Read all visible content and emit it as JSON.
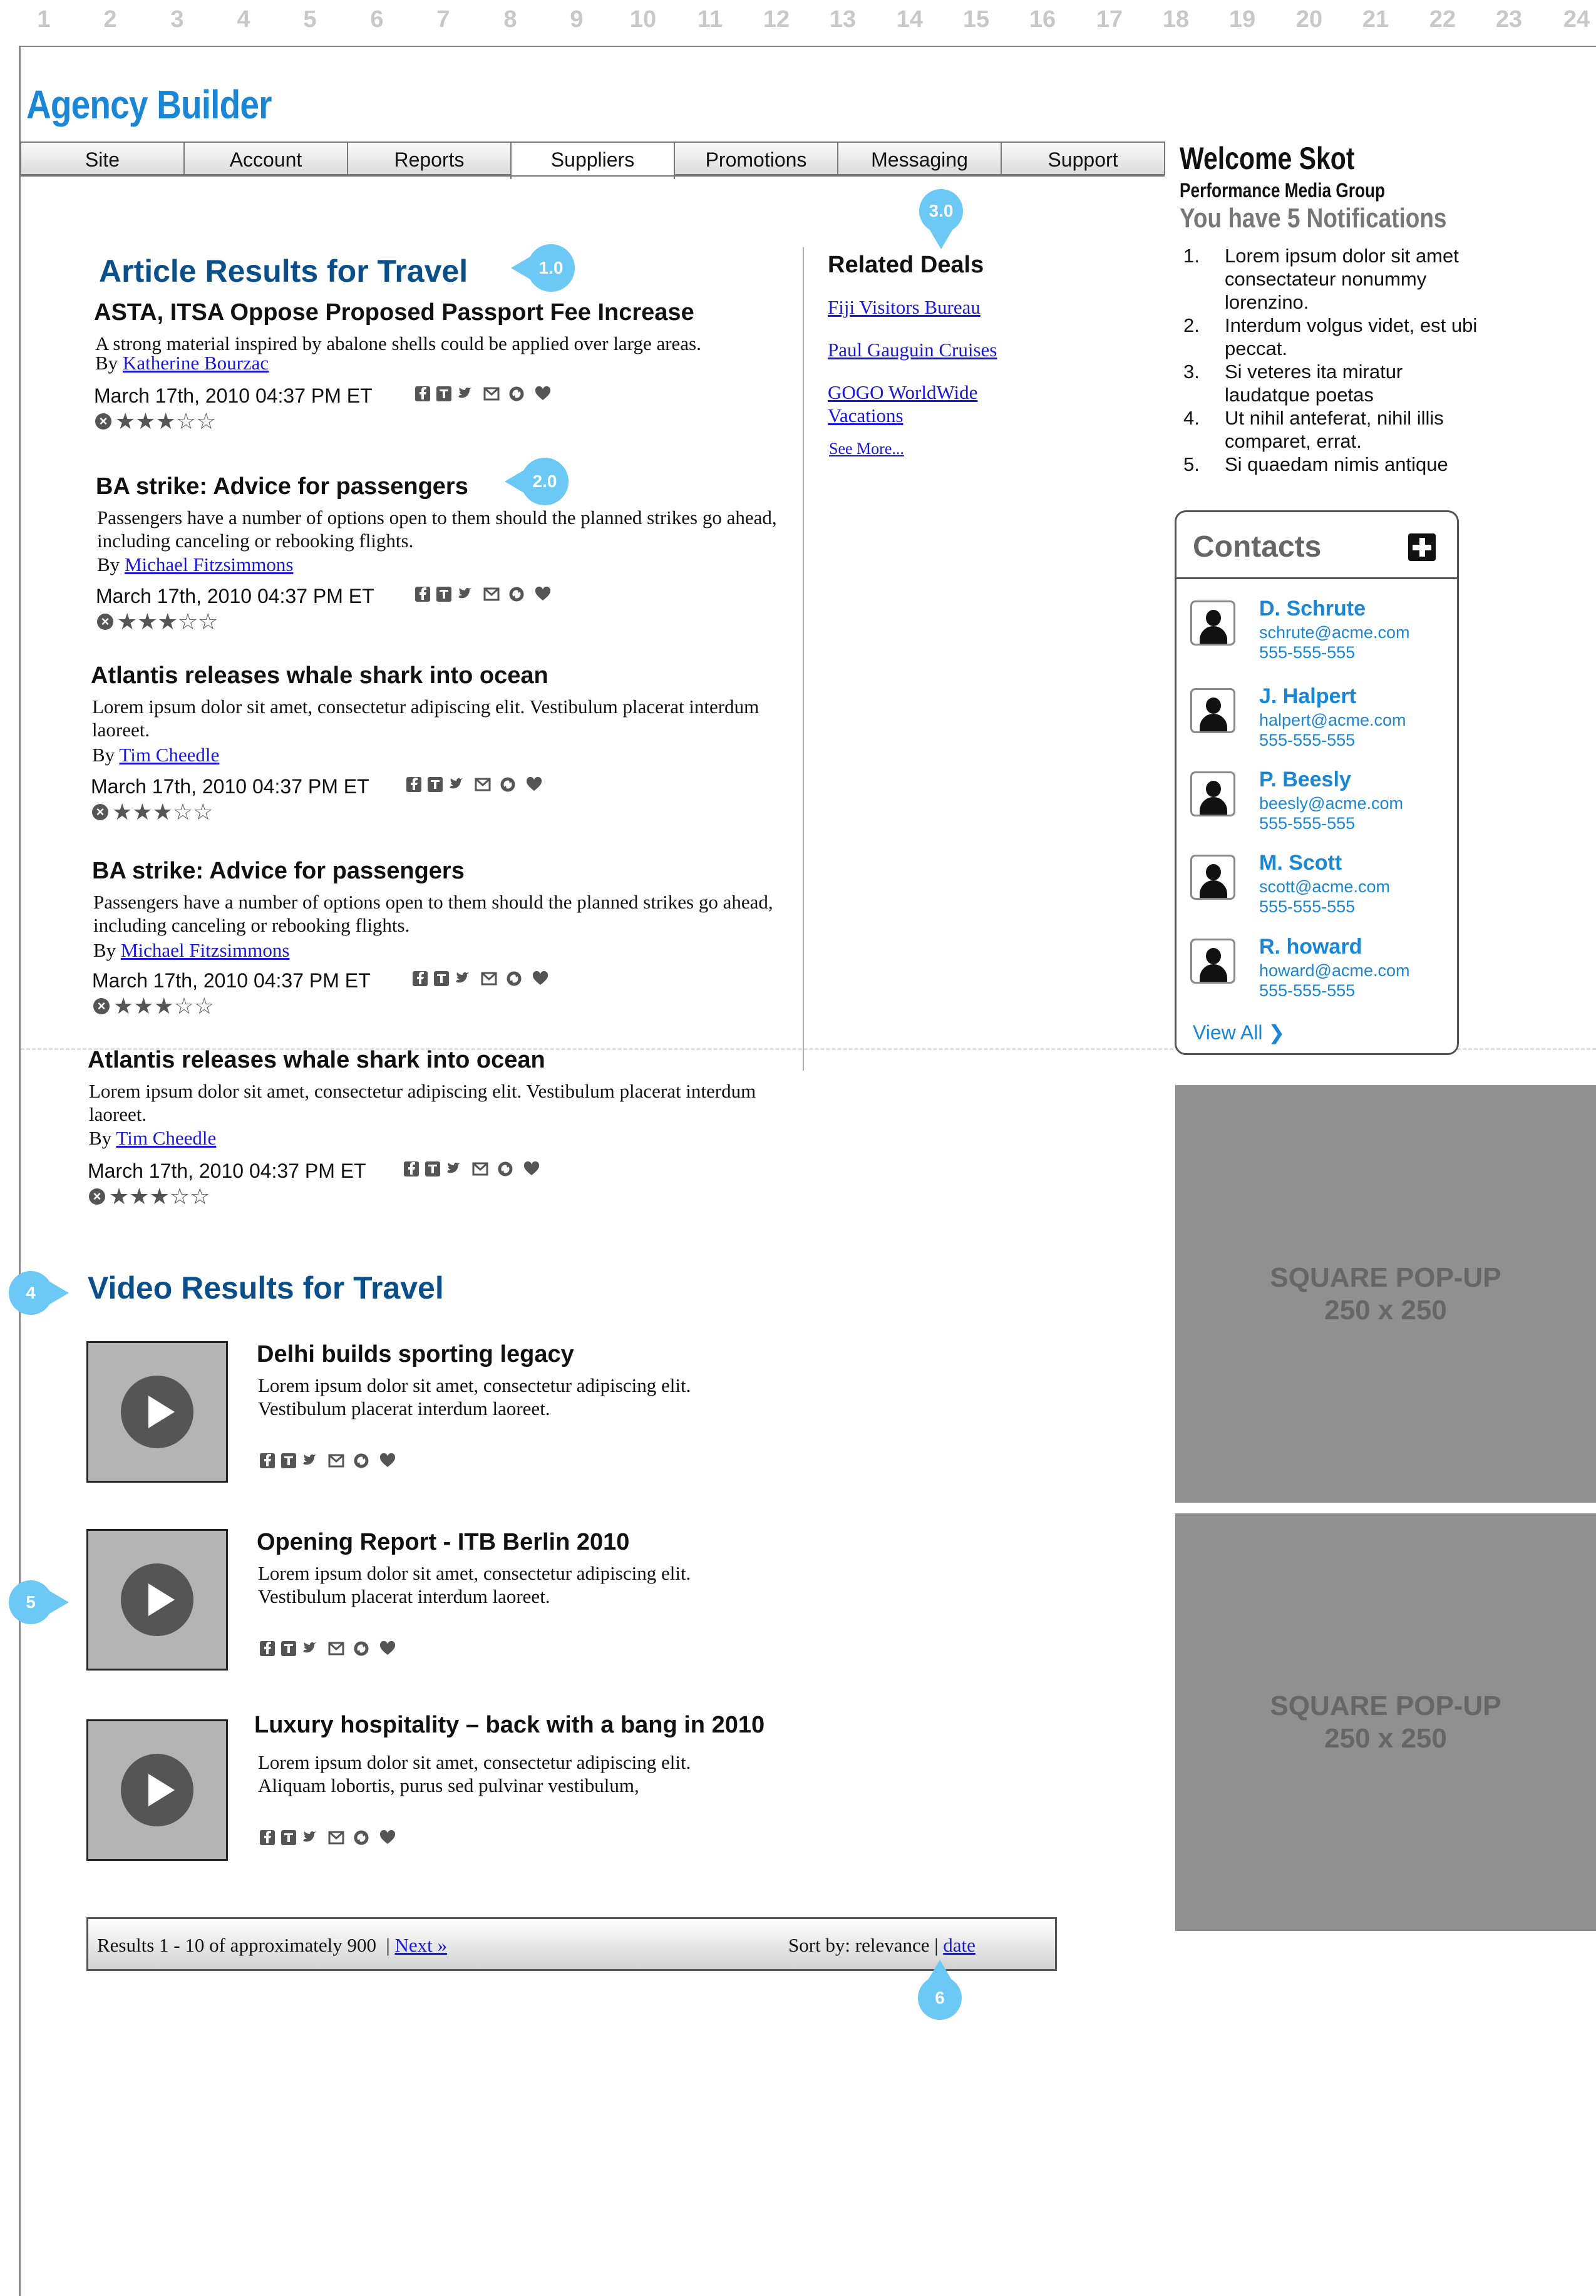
{
  "grid": {
    "columns": [
      "1",
      "2",
      "3",
      "4",
      "5",
      "6",
      "7",
      "8",
      "9",
      "10",
      "11",
      "12",
      "13",
      "14",
      "15",
      "16",
      "17",
      "18",
      "19",
      "20",
      "21",
      "22",
      "23",
      "24"
    ]
  },
  "app": {
    "title": "Agency Builder",
    "accent": "#1a86d6"
  },
  "nav": {
    "tabs": [
      {
        "label": "Site",
        "active": false
      },
      {
        "label": "Account",
        "active": false
      },
      {
        "label": "Reports",
        "active": false
      },
      {
        "label": "Suppliers",
        "active": true
      },
      {
        "label": "Promotions",
        "active": false
      },
      {
        "label": "Messaging",
        "active": false
      },
      {
        "label": "Support",
        "active": false
      }
    ]
  },
  "welcome": {
    "title": "Welcome Skot",
    "org": "Performance Media Group",
    "notifications_heading": "You have 5 Notifications",
    "notifications": [
      {
        "num": "1.",
        "text": "Lorem ipsum dolor sit amet consectateur nonummy lorenzino."
      },
      {
        "num": "2.",
        "text": "Interdum volgus videt, est ubi peccat."
      },
      {
        "num": "3.",
        "text": "Si veteres ita miratur laudatque poetas"
      },
      {
        "num": "4.",
        "text": "Ut nihil anteferat, nihil illis comparet, errat."
      },
      {
        "num": "5.",
        "text": "Si quaedam nimis antique"
      }
    ]
  },
  "contacts": {
    "title": "Contacts",
    "view_all": "View All ❯",
    "items": [
      {
        "name": "D. Schrute",
        "email": "schrute@acme.com",
        "phone": "555-555-555"
      },
      {
        "name": "J. Halpert",
        "email": "halpert@acme.com",
        "phone": "555-555-555"
      },
      {
        "name": "P. Beesly",
        "email": "beesly@acme.com",
        "phone": "555-555-555"
      },
      {
        "name": "M. Scott",
        "email": "scott@acme.com",
        "phone": "555-555-555"
      },
      {
        "name": "R. howard",
        "email": "howard@acme.com",
        "phone": "555-555-555"
      }
    ]
  },
  "ads": [
    {
      "line1": "SQUARE POP-UP",
      "line2": "250 x 250"
    },
    {
      "line1": "SQUARE POP-UP",
      "line2": "250 x 250"
    }
  ],
  "articles": {
    "title": "Article Results for Travel",
    "items": [
      {
        "title": "ASTA, ITSA Oppose Proposed Passport Fee Increase",
        "desc": "A strong material inspired by abalone shells could be applied over large areas.",
        "by": "By",
        "author": "Katherine Bourzac",
        "date": "March 17th, 2010 04:37 PM ET",
        "rating": 3
      },
      {
        "title": "BA strike: Advice for passengers",
        "desc": "Passengers have a number of options open to them should the planned strikes go ahead, including canceling or rebooking flights.",
        "by": "By",
        "author": "Michael Fitzsimmons",
        "date": "March 17th, 2010 04:37 PM ET",
        "rating": 3
      },
      {
        "title": "Atlantis releases whale shark into ocean",
        "desc": "Lorem ipsum dolor sit amet, consectetur adipiscing elit. Vestibulum placerat interdum laoreet.",
        "by": "By",
        "author": "Tim Cheedle",
        "date": "March 17th, 2010 04:37 PM ET",
        "rating": 3
      },
      {
        "title": "BA strike: Advice for passengers",
        "desc": "Passengers have a number of options open to them should the planned strikes go ahead, including canceling or rebooking flights.",
        "by": "By",
        "author": "Michael Fitzsimmons",
        "date": "March 17th, 2010 04:37 PM ET",
        "rating": 3
      },
      {
        "title": "Atlantis releases whale shark into ocean",
        "desc": "Lorem ipsum dolor sit amet, consectetur adipiscing elit. Vestibulum placerat interdum laoreet.",
        "by": "By",
        "author": "Tim Cheedle",
        "date": "March 17th, 2010 04:37 PM ET",
        "rating": 3
      }
    ]
  },
  "related": {
    "title": "Related Deals",
    "links": [
      "Fiji Visitors Bureau",
      "Paul Gauguin Cruises",
      "GOGO WorldWide Vacations"
    ],
    "see_more": "See More..."
  },
  "videos": {
    "title": "Video Results for Travel",
    "items": [
      {
        "title": "Delhi builds sporting legacy",
        "desc": "Lorem ipsum dolor sit amet, consectetur adipiscing elit. Vestibulum placerat interdum laoreet."
      },
      {
        "title": "Opening Report - ITB Berlin 2010",
        "desc": "Lorem ipsum dolor sit amet, consectetur adipiscing elit. Vestibulum placerat interdum laoreet."
      },
      {
        "title": "Luxury hospitality – back with a bang in 2010",
        "desc": "Lorem ipsum dolor sit amet, consectetur adipiscing elit. Aliquam lobortis, purus sed pulvinar vestibulum,"
      }
    ]
  },
  "results": {
    "summary": "Results 1 - 10 of approximately 900",
    "next": "Next »",
    "sort_label": "Sort by: relevance",
    "sort_date": "date"
  },
  "annotations": [
    "1.0",
    "2.0",
    "3.0",
    "4",
    "5",
    "6"
  ],
  "share_icons": [
    "facebook-icon",
    "technorati-icon",
    "twitter-icon",
    "email-icon",
    "share-icon",
    "favorite-icon"
  ]
}
